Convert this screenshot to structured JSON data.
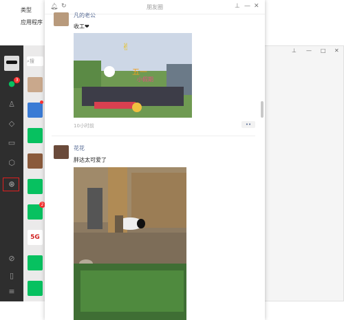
{
  "explorer": {
    "col_type": "类型",
    "row_type": "应用程序"
  },
  "moments": {
    "window_title": "朋友圈",
    "posts": [
      {
        "name": "凡的老公",
        "text": "收工❤",
        "time": "10小时前",
        "more": "••"
      },
      {
        "name": "花花",
        "text": "胖达太可爱了"
      }
    ]
  },
  "wechat": {
    "search_placeholder": "搜",
    "unread_chat_badge": "3",
    "chat_badges": [
      "",
      "2"
    ]
  },
  "colors": {
    "accent": "#07c160",
    "sidebar": "#2e2e2e",
    "link": "#576b95",
    "highlight": "#e02020"
  }
}
